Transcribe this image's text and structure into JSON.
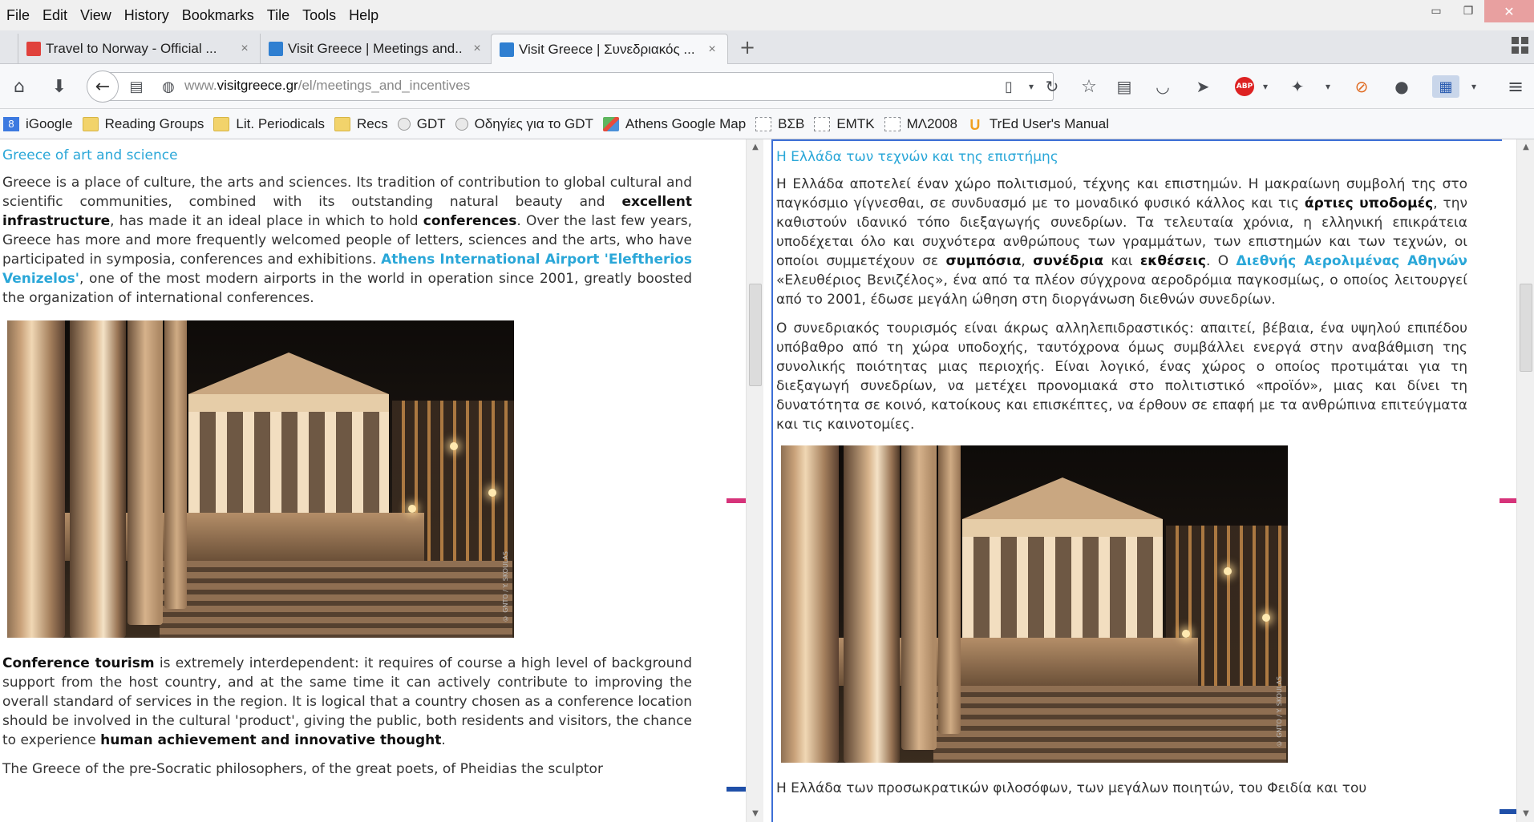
{
  "menu": [
    "File",
    "Edit",
    "View",
    "History",
    "Bookmarks",
    "Tile",
    "Tools",
    "Help"
  ],
  "window_controls": {
    "minimize": "▭",
    "restore": "❐",
    "close": "✕"
  },
  "tabs": [
    {
      "label": "Travel to Norway - Official ...",
      "close": "×",
      "favicon_color": "#e0413c"
    },
    {
      "label": "Visit Greece | Meetings and...",
      "close": "×",
      "favicon_color": "#2f7fd1"
    },
    {
      "label": "Visit Greece | Συνεδριακός ...",
      "close": "×",
      "favicon_color": "#2f7fd1"
    }
  ],
  "newtab_label": "+",
  "url": {
    "prefix": "www.",
    "domain": "visitgreece.gr",
    "path": "/el/meetings_and_incentives"
  },
  "bookmarks": [
    {
      "label": "iGoogle",
      "icon": "google-icon"
    },
    {
      "label": "Reading Groups",
      "icon": "folder-icon"
    },
    {
      "label": "Lit. Periodicals",
      "icon": "folder-icon"
    },
    {
      "label": "Recs",
      "icon": "folder-icon"
    },
    {
      "label": "GDT",
      "icon": "globe-icon"
    },
    {
      "label": "Οδηγίες για το GDT",
      "icon": "globe-icon"
    },
    {
      "label": "Athens Google Map",
      "icon": "map-icon"
    },
    {
      "label": "ΒΣΒ",
      "icon": "page-icon"
    },
    {
      "label": "EMTK",
      "icon": "page-icon"
    },
    {
      "label": "ΜΛ2008",
      "icon": "page-icon"
    },
    {
      "label": "TrEd User's Manual",
      "icon": "u-icon"
    }
  ],
  "left": {
    "title": "Greece of art and science",
    "p1": {
      "a": "Greece is a place of culture, the arts and sciences. Its tradition of contribution to global cultural and scientific communities, combined with its outstanding natural beauty and ",
      "b1": "excellent infrastructure",
      "c": ", has made it an ideal place in which to hold ",
      "b2": "conferences",
      "d": ". Over the last few years, Greece has more and more frequently welcomed people of letters, sciences and the arts, who have participated in symposia, conferences and exhibitions. ",
      "link": "Athens International Airport 'Eleftherios Venizelos'",
      "e": ", one of the most modern airports in the world in operation since 2001, greatly boosted the organization of international conferences."
    },
    "p2": {
      "b1": "Conference tourism",
      "a": " is extremely interdependent: it requires of course a high level of background support from the host country, and at the same time it can actively contribute to improving the overall standard of services in the region. It is logical that a country chosen as a conference location should be involved in the cultural 'product', giving the public, both residents and visitors, the chance to experience ",
      "b2": "human achievement and innovative thought",
      "c": "."
    },
    "p3": "The Greece of the pre-Socratic philosophers, of the great poets, of Pheidias the sculptor",
    "photo_credit": "© GNTO / Y. SKOULAS"
  },
  "right": {
    "title": "Η Ελλάδα των τεχνών και της επιστήμης",
    "p1": {
      "a": "Η Ελλάδα αποτελεί έναν χώρο πολιτισμού, τέχνης και επιστημών. Η μακραίωνη συμβολή της στο παγκόσμιο γίγνεσθαι, σε συνδυασμό με το μοναδικό φυσικό κάλλος και τις ",
      "b1": "άρτιες υποδομές",
      "c": ", την καθιστούν ιδανικό τόπο διεξαγωγής συνεδρίων. Τα τελευταία χρόνια, η ελληνική επικράτεια υποδέχεται όλο και συχνότερα ανθρώπους των γραμμάτων, των επιστημών και των τεχνών, οι οποίοι συμμετέχουν σε ",
      "b2": "συμπόσια",
      "sep": ", ",
      "b3": "συνέδρια",
      "and": " και ",
      "b4": "εκθέσεις",
      "d": ". Ο ",
      "link": "Διεθνής Αερολιμένας Αθηνών",
      "e": " «Ελευθέριος Βενιζέλος», ένα από τα πλέον σύγχρονα αεροδρόμια παγκοσμίως, ο οποίος λειτουργεί από το 2001, έδωσε μεγάλη ώθηση στη διοργάνωση διεθνών συνεδρίων."
    },
    "p2": "Ο συνεδριακός τουρισμός είναι άκρως αλληλεπιδραστικός: απαιτεί, βέβαια, ένα υψηλού επιπέδου υπόβαθρο από τη χώρα υποδοχής, ταυτόχρονα όμως συμβάλλει ενεργά στην αναβάθμιση της συνολικής ποιότητας μιας περιοχής. Είναι λογικό, ένας χώρος ο οποίος προτιμάται για τη διεξαγωγή συνεδρίων, να μετέχει προνομιακά στο πολιτιστικό «προϊόν», μιας και δίνει τη δυνατότητα σε κοινό, κατοίκους και επισκέπτες, να έρθουν σε επαφή με τα ανθρώπινα επιτεύγματα και τις καινοτομίες.",
    "p3": "Η Ελλάδα των προσωκρατικών φιλοσόφων, των μεγάλων ποιητών, του Φειδία και του",
    "photo_credit": "© GNTO / Y. SKOULAS"
  },
  "colors": {
    "link": "#2aa7d8",
    "split_border": "#3d6fd6",
    "marker_pink": "#d6337a",
    "marker_blue": "#1f4fa8"
  }
}
